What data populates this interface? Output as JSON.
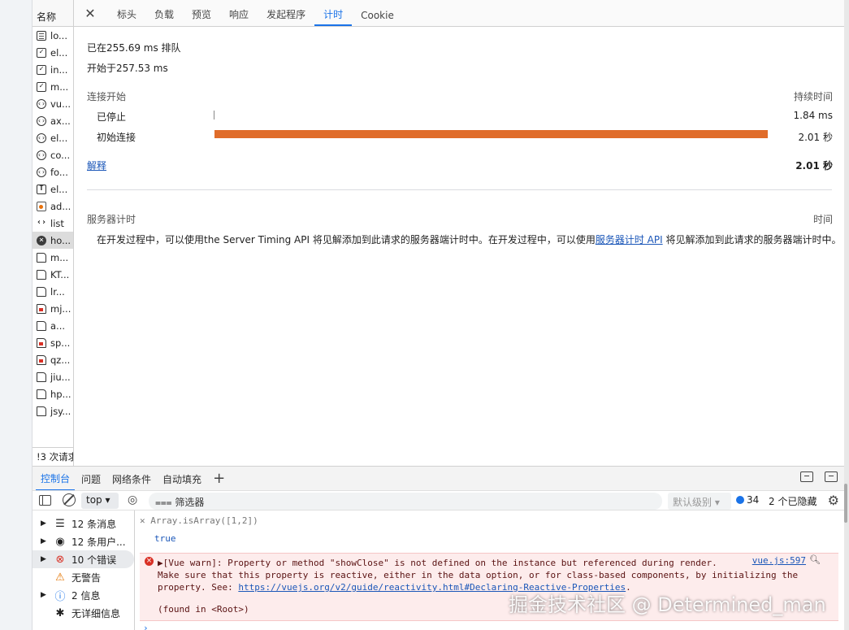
{
  "network": {
    "name_header": "名称",
    "requests": [
      {
        "name": "lo...",
        "icon": "doc"
      },
      {
        "name": "el...",
        "icon": "check"
      },
      {
        "name": "in...",
        "icon": "check"
      },
      {
        "name": "m...",
        "icon": "check"
      },
      {
        "name": "vu...",
        "icon": "code"
      },
      {
        "name": "ax...",
        "icon": "code"
      },
      {
        "name": "el...",
        "icon": "code"
      },
      {
        "name": "co...",
        "icon": "code"
      },
      {
        "name": "fo...",
        "icon": "code"
      },
      {
        "name": "el...",
        "icon": "text"
      },
      {
        "name": "ad...",
        "icon": "img"
      },
      {
        "name": "list",
        "icon": "list"
      },
      {
        "name": "ho...",
        "icon": "err",
        "selected": true
      },
      {
        "name": "m...",
        "icon": "file"
      },
      {
        "name": "KT...",
        "icon": "file"
      },
      {
        "name": "lr...",
        "icon": "file"
      },
      {
        "name": "mj...",
        "icon": "file-red"
      },
      {
        "name": "a...",
        "icon": "file"
      },
      {
        "name": "sp...",
        "icon": "file-red"
      },
      {
        "name": "qz...",
        "icon": "file-red"
      },
      {
        "name": "jiu...",
        "icon": "file"
      },
      {
        "name": "hp...",
        "icon": "file"
      },
      {
        "name": "jsy...",
        "icon": "file"
      }
    ],
    "footer": "!3 次请求"
  },
  "details": {
    "tabs": [
      "标头",
      "负载",
      "预览",
      "响应",
      "发起程序",
      "计时",
      "Cookie"
    ],
    "active_tab": "计时",
    "queued": "已在255.69 ms 排队",
    "started": "开始于257.53 ms",
    "connection_start": "连接开始",
    "duration_header": "持续时间",
    "stalled_label": "已停止",
    "stalled_value": "1.84 ms",
    "initial_label": "初始连接",
    "initial_value": "2.01 秒",
    "explain_link": "解释",
    "total_value": "2.01 秒",
    "server_timing": "服务器计时",
    "time_header": "时间",
    "server_text_1": "在开发过程中，可以使用the Server Timing API 将见解添加到此请求的服务器端计时中。在开发过程中，可以使用",
    "server_link": "服务器计时 API",
    "server_text_2": " 将见解添加到此请求的服务器端计时中。"
  },
  "console": {
    "tabs": [
      "控制台",
      "问题",
      "网络条件",
      "自动填充"
    ],
    "active_tab": "控制台",
    "context": "top",
    "filter_placeholder": "筛选器",
    "level": "默认级别",
    "issues_count": "34",
    "hidden": "2 个已隐藏",
    "sidebar": [
      {
        "label": "12 条消息",
        "icon": "☰"
      },
      {
        "label": "12 条用户...",
        "icon": "◉"
      },
      {
        "label": "10 个错误",
        "icon": "⊗",
        "selected": true
      },
      {
        "label": "无警告",
        "icon": "⚠"
      },
      {
        "label": "2 信息",
        "icon": "ⓘ"
      },
      {
        "label": "无详细信息",
        "icon": "✱"
      }
    ],
    "input_expr": "Array.isArray([1,2])",
    "result": "true",
    "error_line_1": "▶[Vue warn]: Property or method \"showClose\" is not defined on the instance but referenced during render.",
    "error_line_2": "Make sure that this property is reactive, either in the data option, or for class-based components, by initializing the",
    "error_line_3_prefix": "property. See: ",
    "error_line_3_link": "https://vuejs.org/v2/guide/reactivity.html#Declaring-Reactive-Properties",
    "error_line_3_suffix": ".",
    "error_line_4": "(found in <Root>)",
    "error_source": "vue.js:597"
  },
  "watermark": "掘金技术社区 @ Determined_man",
  "colors": {
    "accent": "#1a73e8",
    "timing_bar": "#e06c2a",
    "error_bg": "#fdecec",
    "error_icon": "#d93025"
  }
}
